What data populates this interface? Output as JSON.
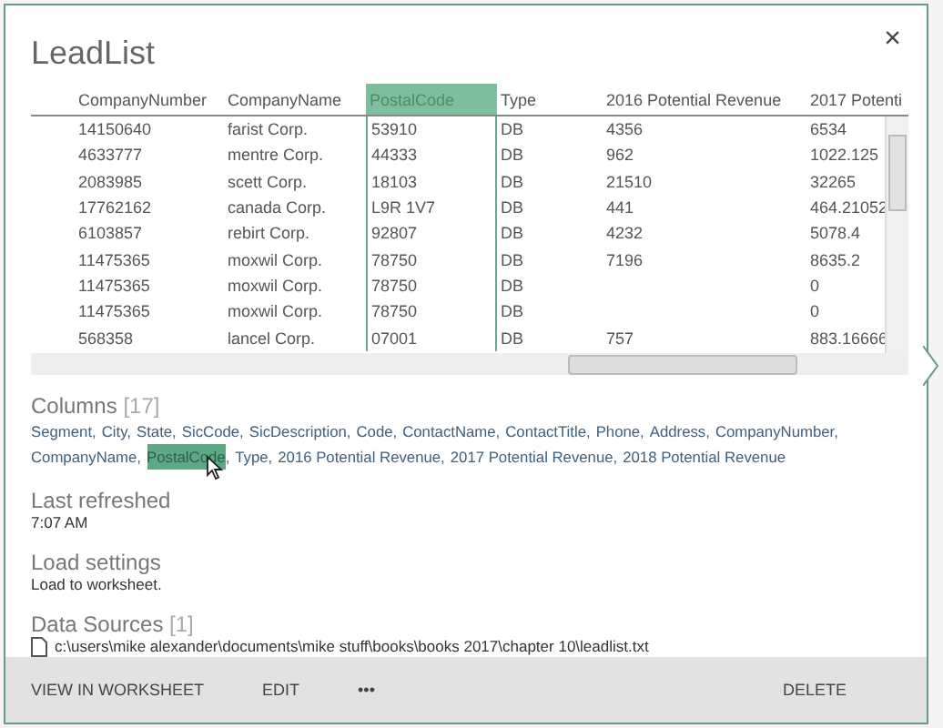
{
  "panel": {
    "title": "LeadList",
    "close": "×"
  },
  "table": {
    "columns": [
      {
        "label": "CompanyNumber",
        "selected": false
      },
      {
        "label": "CompanyName",
        "selected": false
      },
      {
        "label": "PostalCode",
        "selected": true
      },
      {
        "label": "Type",
        "selected": false
      },
      {
        "label": "2016 Potential Revenue",
        "selected": false
      },
      {
        "label": "2017 Potenti",
        "selected": false
      }
    ],
    "rows": [
      [
        "14150640",
        "farist Corp.",
        "53910",
        "DB",
        "4356",
        "6534"
      ],
      [
        "4633777",
        "mentre Corp.",
        "44333",
        "DB",
        "962",
        "1022.125"
      ],
      [
        "2083985",
        "scett Corp.",
        "18103",
        "DB",
        "21510",
        "32265"
      ],
      [
        "17762162",
        "canada Corp.",
        "L9R 1V7",
        "DB",
        "441",
        "464.21052"
      ],
      [
        "6103857",
        "rebirt Corp.",
        "92807",
        "DB",
        "4232",
        "5078.4"
      ],
      [
        "11475365",
        "moxwil Corp.",
        "78750",
        "DB",
        "7196",
        "8635.2"
      ],
      [
        "11475365",
        "moxwil Corp.",
        "78750",
        "DB",
        "",
        "0"
      ],
      [
        "11475365",
        "moxwil Corp.",
        "78750",
        "DB",
        "",
        "0"
      ],
      [
        "568358",
        "lancel Corp.",
        "07001",
        "DB",
        "757",
        "883.16666"
      ]
    ]
  },
  "columns_section": {
    "heading": "Columns",
    "count": "[17]",
    "items": [
      {
        "name": "Segment,",
        "selected": false
      },
      {
        "name": "City,",
        "selected": false
      },
      {
        "name": "State,",
        "selected": false
      },
      {
        "name": "SicCode,",
        "selected": false
      },
      {
        "name": "SicDescription,",
        "selected": false
      },
      {
        "name": "Code,",
        "selected": false
      },
      {
        "name": "ContactName,",
        "selected": false
      },
      {
        "name": "ContactTitle,",
        "selected": false
      },
      {
        "name": "Phone,",
        "selected": false
      },
      {
        "name": "Address,",
        "selected": false
      },
      {
        "name": "CompanyNumber,",
        "selected": false
      },
      {
        "name": "CompanyName,",
        "selected": false
      },
      {
        "name": "PostalCode",
        "selected": true
      },
      {
        "name": ",",
        "selected": false
      },
      {
        "name": "Type,",
        "selected": false
      },
      {
        "name": "2016 Potential Revenue,",
        "selected": false
      },
      {
        "name": "2017 Potential Revenue,",
        "selected": false
      },
      {
        "name": "2018 Potential Revenue",
        "selected": false
      }
    ]
  },
  "last_refreshed": {
    "heading": "Last refreshed",
    "value": "7:07 AM"
  },
  "load_settings": {
    "heading": "Load settings",
    "value": "Load to worksheet."
  },
  "data_sources": {
    "heading": "Data Sources",
    "count": "[1]",
    "path": "c:\\users\\mike alexander\\documents\\mike stuff\\books\\books 2017\\chapter 10\\leadlist.txt"
  },
  "footer": {
    "buttons": [
      "VIEW IN WORKSHEET",
      "EDIT",
      "•••"
    ],
    "delete": "DELETE"
  }
}
